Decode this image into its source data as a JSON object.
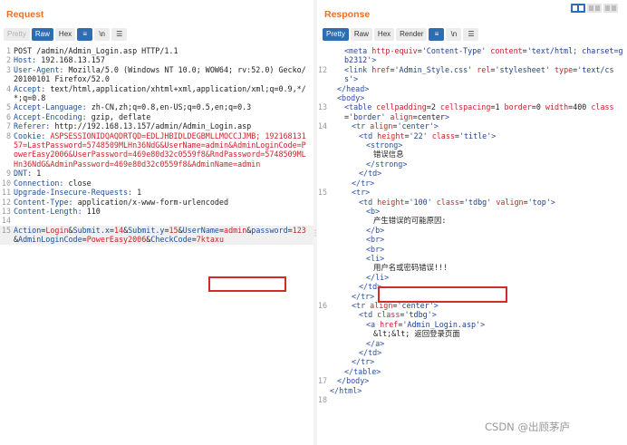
{
  "request": {
    "title": "Request",
    "tabs": [
      "Pretty",
      "Raw",
      "Hex"
    ],
    "active_tab": "Raw",
    "lines": [
      {
        "n": "1",
        "t": "POST /admin/Admin_Login.asp HTTP/1.1"
      },
      {
        "n": "2",
        "k": "Host",
        "v": "192.168.13.157"
      },
      {
        "n": "3",
        "k": "User-Agent",
        "v": "Mozilla/5.0 (Windows NT 10.0; WOW64; rv:52.0) Gecko/20100101 Firefox/52.0"
      },
      {
        "n": "4",
        "k": "Accept",
        "v": "text/html,application/xhtml+xml,application/xml;q=0.9,*/*;q=0.8"
      },
      {
        "n": "5",
        "k": "Accept-Language",
        "v": "zh-CN,zh;q=0.8,en-US;q=0.5,en;q=0.3"
      },
      {
        "n": "6",
        "k": "Accept-Encoding",
        "v": "gzip, deflate"
      },
      {
        "n": "7",
        "k": "Referer",
        "v": "http://192.168.13.157/admin/Admin_Login.asp"
      },
      {
        "n": "8",
        "k": "Cookie",
        "cookie": "ASPSESSIONIDQAQDRTQD=EDLJHBIDLDEGBMLLMOCCJJMB; 19216813157=LastPassword=5748509MLHn36NdG&UserName=admin&AdminLoginCode=PowerEasy2006&UserPassword=469e80d32c0559f8&RndPassword=5748509MLHn36NdG&AdminPassword=469e80d32c0559f8&AdminName=admin"
      },
      {
        "n": "9",
        "k": "DNT",
        "v": "1"
      },
      {
        "n": "10",
        "k": "Connection",
        "v": "close"
      },
      {
        "n": "11",
        "k": "Upgrade-Insecure-Requests",
        "v": "1"
      },
      {
        "n": "12",
        "k": "Content-Type",
        "v": "application/x-www-form-urlencoded"
      },
      {
        "n": "13",
        "k": "Content-Length",
        "v": "110"
      },
      {
        "n": "14",
        "t": ""
      },
      {
        "n": "15",
        "body": [
          [
            "Action",
            "Login"
          ],
          [
            "Submit.x",
            "14"
          ],
          [
            "Submit.y",
            "15"
          ],
          [
            "UserName",
            "admin"
          ],
          [
            "password",
            "123"
          ],
          [
            "AdminLoginCode",
            "PowerEasy2006"
          ],
          [
            "CheckCode",
            "7ktaxu"
          ]
        ]
      }
    ]
  },
  "response": {
    "title": "Response",
    "tabs": [
      "Pretty",
      "Raw",
      "Hex",
      "Render"
    ],
    "active_tab": "Pretty",
    "lines": [
      {
        "n": "",
        "i": 2,
        "t": "<meta http-equiv='Content-Type' content='text/html; charset=gb2312'>"
      },
      {
        "n": "12",
        "i": 2,
        "t": "<link href='Admin_Style.css' rel='stylesheet' type='text/css'>"
      },
      {
        "n": "",
        "i": 1,
        "t": "</head>"
      },
      {
        "n": "",
        "i": 1,
        "t": "<body>"
      },
      {
        "n": "13",
        "i": 2,
        "t": "<table cellpadding=2 cellspacing=1 border=0 width=400 class='border' align=center>"
      },
      {
        "n": "14",
        "i": 3,
        "t": "<tr align='center'>"
      },
      {
        "n": "",
        "i": 4,
        "t": "<td height='22' class='title'>"
      },
      {
        "n": "",
        "i": 5,
        "t": "<strong>"
      },
      {
        "n": "",
        "i": 6,
        "t": "错误信息"
      },
      {
        "n": "",
        "i": 5,
        "t": "</strong>"
      },
      {
        "n": "",
        "i": 4,
        "t": "</td>"
      },
      {
        "n": "",
        "i": 3,
        "t": "</tr>"
      },
      {
        "n": "15",
        "i": 3,
        "t": "<tr>"
      },
      {
        "n": "",
        "i": 4,
        "t": "<td height='100' class='tdbg' valign='top'>"
      },
      {
        "n": "",
        "i": 5,
        "t": "<b>"
      },
      {
        "n": "",
        "i": 6,
        "t": "产生错误的可能原因:"
      },
      {
        "n": "",
        "i": 5,
        "t": "</b>"
      },
      {
        "n": "",
        "i": 5,
        "t": "<br>"
      },
      {
        "n": "",
        "i": 5,
        "t": "<br>"
      },
      {
        "n": "",
        "i": 5,
        "t": "<li>"
      },
      {
        "n": "",
        "i": 6,
        "t": "用户名或密码错误!!!"
      },
      {
        "n": "",
        "i": 5,
        "t": "</li>"
      },
      {
        "n": "",
        "i": 4,
        "t": "</td>"
      },
      {
        "n": "",
        "i": 3,
        "t": "</tr>"
      },
      {
        "n": "16",
        "i": 3,
        "t": "<tr align='center'>"
      },
      {
        "n": "",
        "i": 4,
        "t": "<td class='tdbg'>"
      },
      {
        "n": "",
        "i": 5,
        "t": "<a href='Admin_Login.asp'>"
      },
      {
        "n": "",
        "i": 6,
        "t": "&lt;&lt; 返回登录页面"
      },
      {
        "n": "",
        "i": 5,
        "t": "</a>"
      },
      {
        "n": "",
        "i": 4,
        "t": "</td>"
      },
      {
        "n": "",
        "i": 3,
        "t": "</tr>"
      },
      {
        "n": "",
        "i": 2,
        "t": "</table>"
      },
      {
        "n": "17",
        "i": 1,
        "t": "</body>"
      },
      {
        "n": "",
        "i": 0,
        "t": "</html>"
      },
      {
        "n": "18",
        "i": 0,
        "t": ""
      }
    ]
  },
  "watermark": "CSDN @出顾茅庐",
  "colors": {
    "accent": "#e8702a",
    "active_button": "#2f6cb0",
    "highlight_box": "#d42a2a"
  }
}
